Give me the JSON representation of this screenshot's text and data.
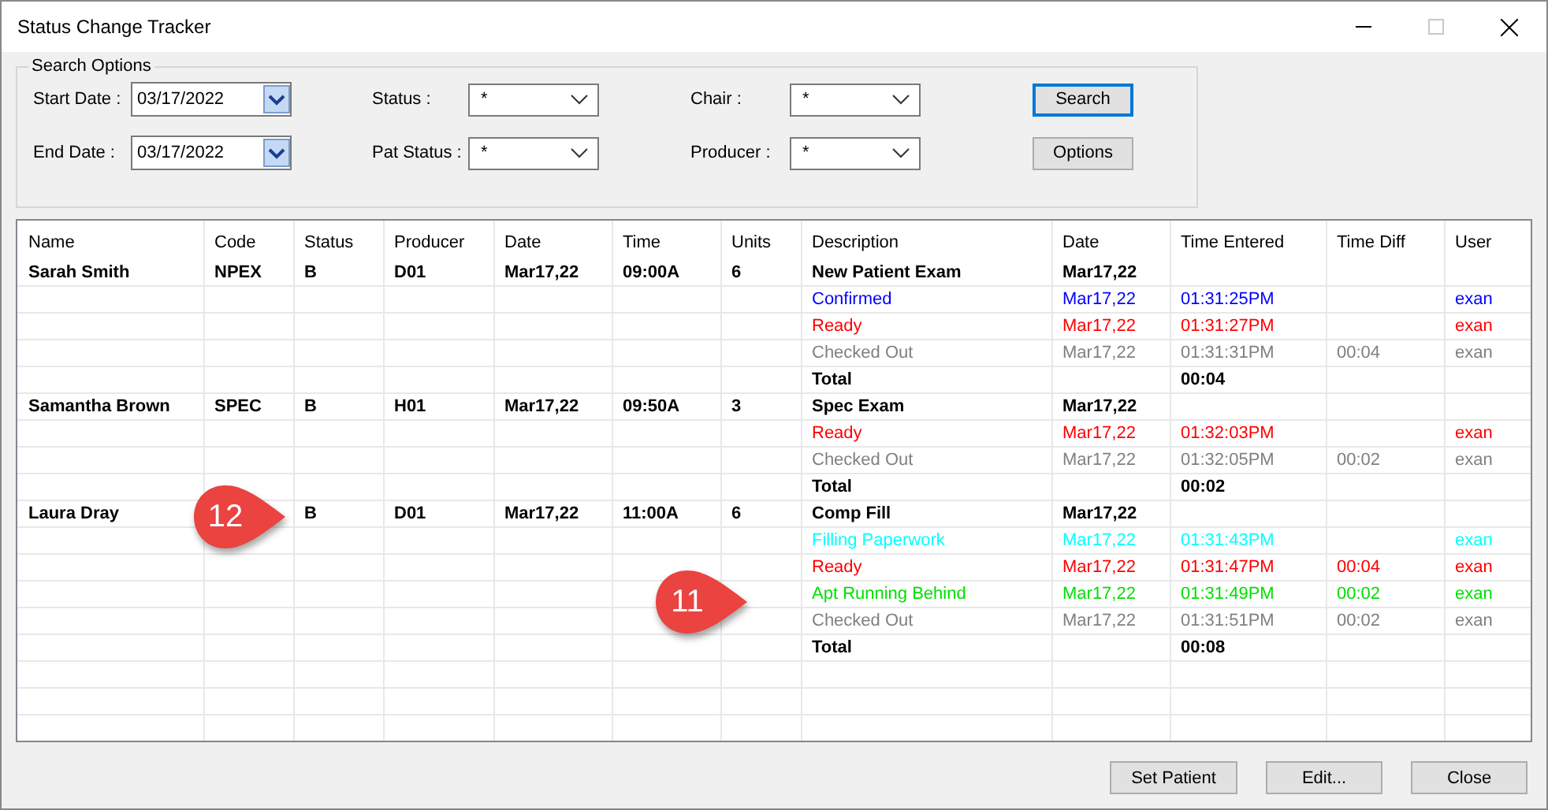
{
  "window": {
    "title": "Status Change Tracker",
    "maximize_disabled": true
  },
  "search_options": {
    "title": "Search Options",
    "fields": [
      {
        "kind": "date",
        "label": "Start Date :",
        "value": "03/17/2022"
      },
      {
        "kind": "combo",
        "label": "Status :",
        "value": "*"
      },
      {
        "kind": "combo",
        "label": "Chair :",
        "value": "*"
      },
      {
        "kind": "button",
        "label": "Search",
        "focused": true
      },
      {
        "kind": "date",
        "label": "End Date :",
        "value": "03/17/2022"
      },
      {
        "kind": "combo",
        "label": "Pat Status :",
        "value": "*"
      },
      {
        "kind": "combo",
        "label": "Producer :",
        "value": "*"
      },
      {
        "kind": "button",
        "label": "Options",
        "focused": false
      }
    ]
  },
  "table": {
    "columns": [
      "Name",
      "Code",
      "Status",
      "Producer",
      "Date",
      "Time",
      "Units",
      "Description",
      "Date",
      "Time Entered",
      "Time Diff",
      "User"
    ],
    "rows": [
      {
        "kind": "appointment",
        "name": "Sarah Smith",
        "code": "NPEX",
        "status": "B",
        "producer": "D01",
        "date": "Mar17,22",
        "time": "09:00A",
        "units": "6",
        "description": "New Patient Exam",
        "desc_date": "Mar17,22"
      },
      {
        "kind": "status",
        "description": "Confirmed",
        "date": "Mar17,22",
        "time_entered": "01:31:25PM",
        "user": "exan",
        "color": "#0000ff"
      },
      {
        "kind": "status",
        "description": "Ready",
        "date": "Mar17,22",
        "time_entered": "01:31:27PM",
        "user": "exan",
        "color": "#ff0000"
      },
      {
        "kind": "status",
        "description": "Checked Out",
        "date": "Mar17,22",
        "time_entered": "01:31:31PM",
        "time_diff": "00:04",
        "user": "exan",
        "color": "#808080"
      },
      {
        "kind": "total",
        "description": "Total",
        "time_entered": "00:04"
      },
      {
        "kind": "appointment",
        "name": "Samantha Brown",
        "code": "SPEC",
        "status": "B",
        "producer": "H01",
        "date": "Mar17,22",
        "time": "09:50A",
        "units": "3",
        "description": "Spec Exam",
        "desc_date": "Mar17,22"
      },
      {
        "kind": "status",
        "description": "Ready",
        "date": "Mar17,22",
        "time_entered": "01:32:03PM",
        "user": "exan",
        "color": "#ff0000"
      },
      {
        "kind": "status",
        "description": "Checked Out",
        "date": "Mar17,22",
        "time_entered": "01:32:05PM",
        "time_diff": "00:02",
        "user": "exan",
        "color": "#808080"
      },
      {
        "kind": "total",
        "description": "Total",
        "time_entered": "00:02"
      },
      {
        "kind": "appointment",
        "name": "Laura Dray",
        "status": "B",
        "producer": "D01",
        "date": "Mar17,22",
        "time": "11:00A",
        "units": "6",
        "description": "Comp Fill",
        "desc_date": "Mar17,22"
      },
      {
        "kind": "status",
        "description": "Filling Paperwork",
        "date": "Mar17,22",
        "time_entered": "01:31:43PM",
        "user": "exan",
        "color": "#00ffff"
      },
      {
        "kind": "status",
        "description": "Ready",
        "date": "Mar17,22",
        "time_entered": "01:31:47PM",
        "time_diff": "00:04",
        "user": "exan",
        "color": "#ff0000"
      },
      {
        "kind": "status",
        "description": "Apt Running Behind",
        "date": "Mar17,22",
        "time_entered": "01:31:49PM",
        "time_diff": "00:02",
        "user": "exan",
        "color": "#00e000"
      },
      {
        "kind": "status",
        "description": "Checked Out",
        "date": "Mar17,22",
        "time_entered": "01:31:51PM",
        "time_diff": "00:02",
        "user": "exan",
        "color": "#808080"
      },
      {
        "kind": "total",
        "description": "Total",
        "time_entered": "00:08"
      }
    ]
  },
  "callouts": [
    {
      "label": "12"
    },
    {
      "label": "11"
    }
  ],
  "buttons": [
    "Set Patient",
    "Edit...",
    "Close"
  ]
}
